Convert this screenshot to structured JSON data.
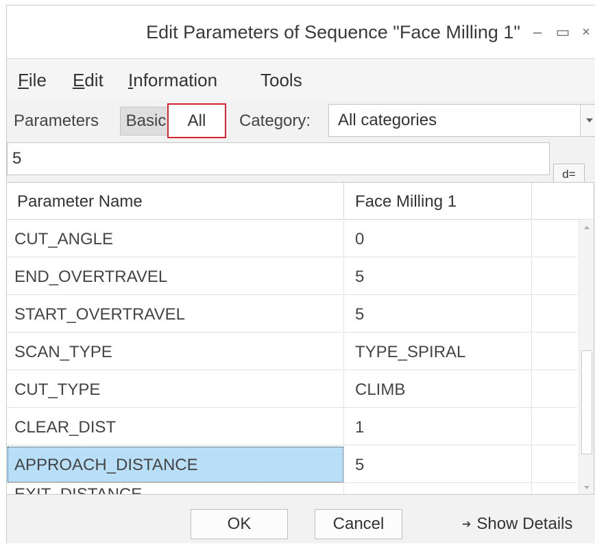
{
  "window": {
    "title": "Edit Parameters of Sequence \"Face Milling 1\"",
    "controls": {
      "minimize": "‒",
      "maximize": "▭",
      "close": "×"
    }
  },
  "menu": [
    {
      "mnemonic": "F",
      "rest": "ile"
    },
    {
      "mnemonic": "E",
      "rest": "dit"
    },
    {
      "mnemonic": "I",
      "rest": "nformation"
    },
    {
      "mnemonic": "",
      "rest": "Tools"
    }
  ],
  "toolbar": {
    "parameters_label": "Parameters",
    "tab_basic": "Basic",
    "tab_all": "All",
    "highlight_color": "#d9232e",
    "category_label": "Category:",
    "category_value": "All categories"
  },
  "value_field": {
    "value": "5",
    "relations_button": "d="
  },
  "table": {
    "headers": [
      "Parameter Name",
      "Face Milling 1",
      ""
    ],
    "rows": [
      {
        "name": "CUT_ANGLE",
        "value": "0"
      },
      {
        "name": "END_OVERTRAVEL",
        "value": "5"
      },
      {
        "name": "START_OVERTRAVEL",
        "value": "5"
      },
      {
        "name": "SCAN_TYPE",
        "value": "TYPE_SPIRAL"
      },
      {
        "name": "CUT_TYPE",
        "value": "CLIMB"
      },
      {
        "name": "CLEAR_DIST",
        "value": "1"
      },
      {
        "name": "APPROACH_DISTANCE",
        "value": "5"
      },
      {
        "name": "EXIT_DISTANCE",
        "value": ""
      }
    ],
    "selected_row_index": 6,
    "selection_color": "#b8dff7"
  },
  "footer": {
    "ok": "OK",
    "cancel": "Cancel",
    "show_details": "Show Details",
    "show_details_icon": "arrow-right-icon"
  }
}
